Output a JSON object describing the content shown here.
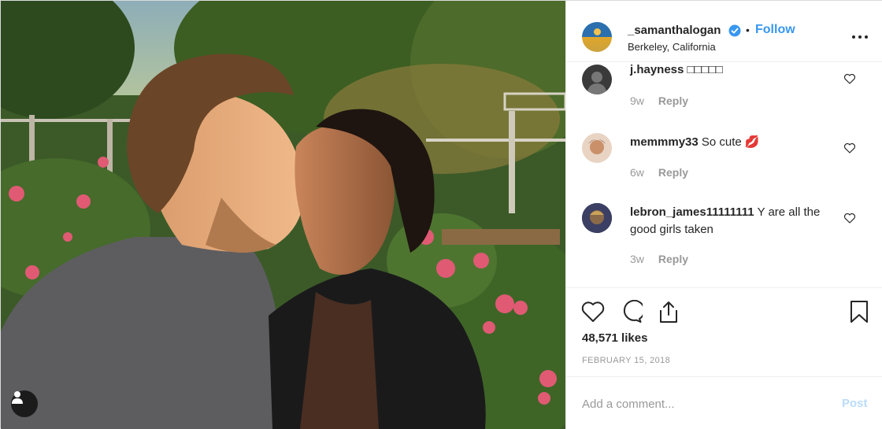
{
  "post": {
    "username": "_samanthalogan",
    "follow_label": "Follow",
    "separator": "•",
    "location": "Berkeley, California",
    "verified": true,
    "more_icon": "more-horizontal-icon"
  },
  "comments": [
    {
      "user": "j.hayness",
      "text": "□□□□□",
      "age": "9w",
      "reply_label": "Reply"
    },
    {
      "user": "memmmy33",
      "text": "So cute 💋",
      "age": "6w",
      "reply_label": "Reply"
    },
    {
      "user": "lebron_james11111111",
      "text": "Y are all the good girls taken",
      "age": "3w",
      "reply_label": "Reply"
    }
  ],
  "actions": {
    "like_icon": "heart-outline-icon",
    "comment_icon": "comment-bubble-icon",
    "share_icon": "share-upload-icon",
    "save_icon": "bookmark-icon"
  },
  "likes": "48,571 likes",
  "date": "FEBRUARY 15, 2018",
  "add_comment": {
    "placeholder": "Add a comment...",
    "post_label": "Post"
  },
  "colors": {
    "link": "#3897f0",
    "post_disabled": "#b9dcfb",
    "muted": "#999999",
    "text": "#262626"
  }
}
